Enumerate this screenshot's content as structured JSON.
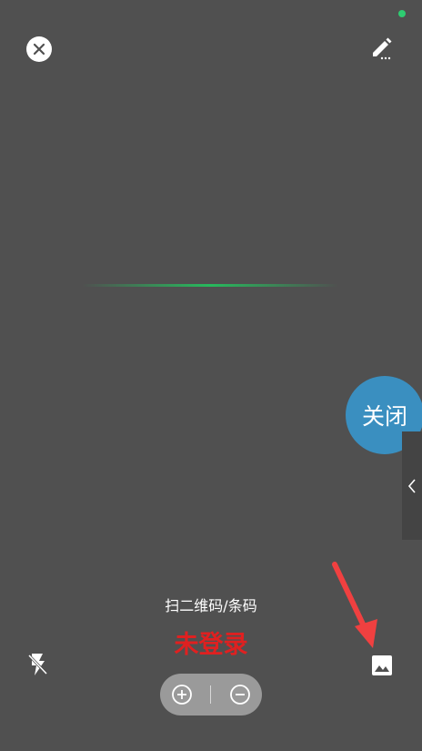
{
  "scanner": {
    "hint": "扫二维码/条码",
    "login_status": "未登录",
    "float_button_label": "关闭"
  },
  "icons": {
    "close": "close-icon",
    "edit": "edit-icon",
    "flash": "flash-off-icon",
    "album": "image-icon",
    "zoom_in": "zoom-in-icon",
    "zoom_out": "zoom-out-icon",
    "side_tab": "chevron-left-icon"
  },
  "colors": {
    "background": "#505050",
    "scan_line": "#22c55e",
    "login_status": "#e02020",
    "float_button": "#3a8fc0",
    "arrow": "#f04040",
    "status_dot": "#2ecc71"
  }
}
